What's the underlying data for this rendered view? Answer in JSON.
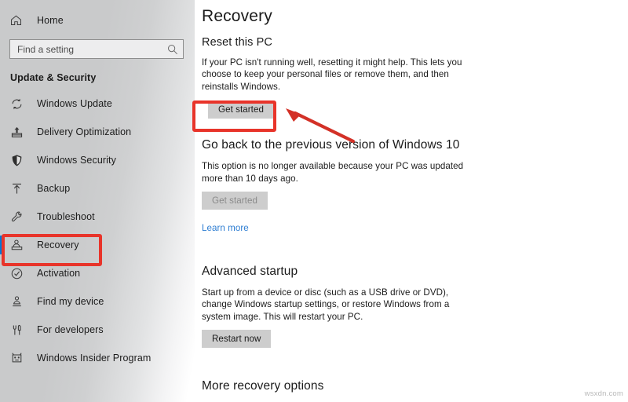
{
  "sidebar": {
    "home": {
      "label": "Home",
      "icon": "home-icon"
    },
    "search": {
      "value": "",
      "placeholder": "Find a setting",
      "icon": "search-icon"
    },
    "section_title": "Update & Security",
    "items": [
      {
        "label": "Windows Update",
        "icon": "sync-icon",
        "selected": false
      },
      {
        "label": "Delivery Optimization",
        "icon": "upload-box-icon",
        "selected": false
      },
      {
        "label": "Windows Security",
        "icon": "shield-icon",
        "selected": false
      },
      {
        "label": "Backup",
        "icon": "upload-arrow-icon",
        "selected": false
      },
      {
        "label": "Troubleshoot",
        "icon": "wrench-icon",
        "selected": false
      },
      {
        "label": "Recovery",
        "icon": "recovery-icon",
        "selected": true
      },
      {
        "label": "Activation",
        "icon": "check-circle-icon",
        "selected": false
      },
      {
        "label": "Find my device",
        "icon": "person-pin-icon",
        "selected": false
      },
      {
        "label": "For developers",
        "icon": "tools-icon",
        "selected": false
      },
      {
        "label": "Windows Insider Program",
        "icon": "insider-bug-icon",
        "selected": false
      }
    ]
  },
  "main": {
    "page_title": "Recovery",
    "reset_pc": {
      "heading": "Reset this PC",
      "description": "If your PC isn't running well, resetting it might help. This lets you choose to keep your personal files or remove them, and then reinstalls Windows.",
      "button_label": "Get started"
    },
    "go_back": {
      "heading": "Go back to the previous version of Windows 10",
      "description": "This option is no longer available because your PC was updated more than 10 days ago.",
      "button_label": "Get started",
      "link_label": "Learn more"
    },
    "advanced_startup": {
      "heading": "Advanced startup",
      "description": "Start up from a device or disc (such as a USB drive or DVD), change Windows startup settings, or restore Windows from a system image. This will restart your PC.",
      "button_label": "Restart now"
    },
    "more_recovery": {
      "heading": "More recovery options"
    }
  },
  "annotations": {
    "color": "#e8342a",
    "sidebar_highlight_target": "Recovery",
    "button_highlight_target": "Get started",
    "arrow": "points-left-to-get-started-button"
  },
  "watermark": {
    "text": "wsxdn.com"
  },
  "colors": {
    "accent": "#0078d7",
    "link": "#2d7dd2",
    "annotation_red": "#e8342a",
    "button_face": "#cdcdcd",
    "sidebar_gray": "#c9cacb"
  }
}
